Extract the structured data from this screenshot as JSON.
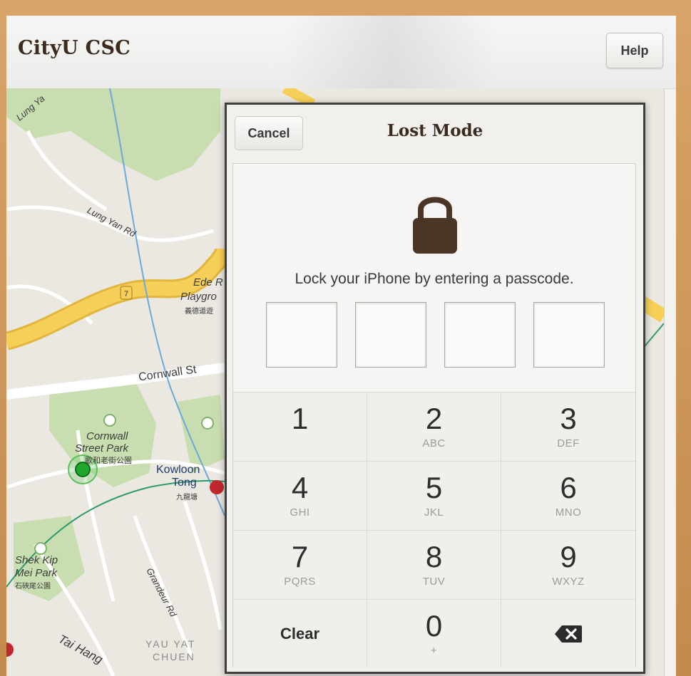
{
  "header": {
    "title": "CityU CSC",
    "help_label": "Help"
  },
  "map": {
    "labels": {
      "lung_yan": "Lung Ya",
      "lung_yan_rd": "Lung Yan Rd",
      "ede": "Ede R",
      "playgr": "Playgro",
      "playgr_cn": "義德道遊",
      "cornwall_st": "Cornwall St",
      "cornwall_park_1": "Cornwall",
      "cornwall_park_2": "Street Park",
      "cornwall_park_cn": "歌和老街公園",
      "kowloon": "Kowloon",
      "tong": "Tong",
      "tong_cn": "九龍塘",
      "shek_kip_1": "Shek Kip",
      "shek_kip_2": "Mei Park",
      "shek_kip_cn": "石硤尾公園",
      "grandeur": "Grandeur Rd",
      "tai_hang": "Tai Hang",
      "yau_yat_1": "YAU YAT",
      "yau_yat_2": "CHUEN",
      "route_num": "7"
    }
  },
  "modal": {
    "cancel_label": "Cancel",
    "title": "Lost Mode",
    "instruction": "Lock your iPhone by entering a passcode.",
    "keys": [
      {
        "digit": "1",
        "letters": ""
      },
      {
        "digit": "2",
        "letters": "ABC"
      },
      {
        "digit": "3",
        "letters": "DEF"
      },
      {
        "digit": "4",
        "letters": "GHI"
      },
      {
        "digit": "5",
        "letters": "JKL"
      },
      {
        "digit": "6",
        "letters": "MNO"
      },
      {
        "digit": "7",
        "letters": "PQRS"
      },
      {
        "digit": "8",
        "letters": "TUV"
      },
      {
        "digit": "9",
        "letters": "WXYZ"
      },
      {
        "digit": "0",
        "letters": "+"
      }
    ],
    "clear_label": "Clear",
    "delete_icon": "backspace-icon"
  },
  "colors": {
    "title_brown": "#3b2a1d",
    "lock_brown": "#4b3526",
    "frame_wood": "#c9935a",
    "road_yellow": "#f6cf58",
    "park_green": "#c9deb0"
  }
}
